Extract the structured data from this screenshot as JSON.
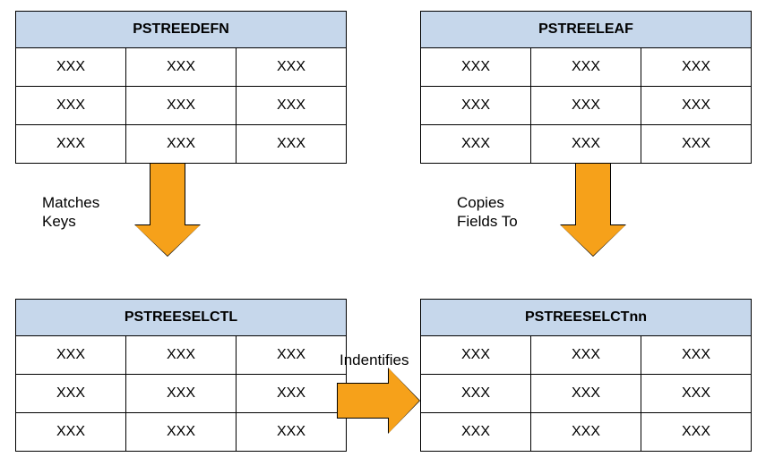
{
  "colors": {
    "table_header": "#c6d7eb",
    "arrow_fill": "#f6a11a"
  },
  "tables": {
    "top_left": {
      "title": "PSTREEDEFN",
      "rows": [
        [
          "XXX",
          "XXX",
          "XXX"
        ],
        [
          "XXX",
          "XXX",
          "XXX"
        ],
        [
          "XXX",
          "XXX",
          "XXX"
        ]
      ]
    },
    "top_right": {
      "title": "PSTREELEAF",
      "rows": [
        [
          "XXX",
          "XXX",
          "XXX"
        ],
        [
          "XXX",
          "XXX",
          "XXX"
        ],
        [
          "XXX",
          "XXX",
          "XXX"
        ]
      ]
    },
    "bottom_left": {
      "title": "PSTREESELCTL",
      "rows": [
        [
          "XXX",
          "XXX",
          "XXX"
        ],
        [
          "XXX",
          "XXX",
          "XXX"
        ],
        [
          "XXX",
          "XXX",
          "XXX"
        ]
      ]
    },
    "bottom_right": {
      "title": "PSTREESELCTnn",
      "rows": [
        [
          "XXX",
          "XXX",
          "XXX"
        ],
        [
          "XXX",
          "XXX",
          "XXX"
        ],
        [
          "XXX",
          "XXX",
          "XXX"
        ]
      ]
    }
  },
  "arrows": {
    "left_down": {
      "from": "top_left",
      "to": "bottom_left",
      "label": "Matches\nKeys"
    },
    "right_down": {
      "from": "top_right",
      "to": "bottom_right",
      "label": "Copies\nFields To"
    },
    "middle_right": {
      "from": "bottom_left",
      "to": "bottom_right",
      "label": "Indentifies"
    }
  }
}
